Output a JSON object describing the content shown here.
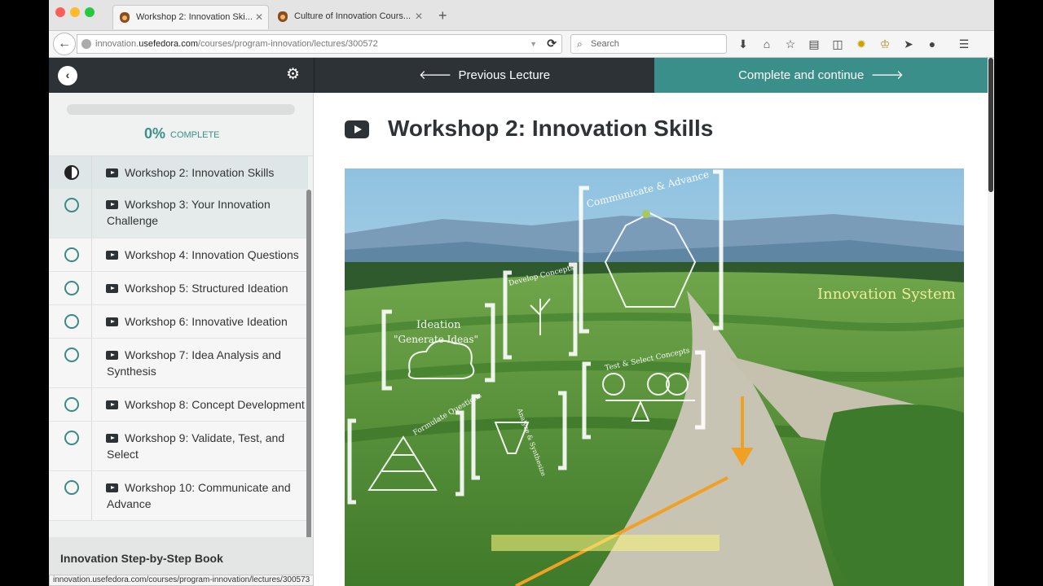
{
  "browser": {
    "tabs": [
      {
        "label": "Workshop 2: Innovation Ski...",
        "active": true
      },
      {
        "label": "Culture of Innovation Cours...",
        "active": false
      }
    ],
    "url_prefix": "innovation.",
    "url_domain": "usefedora.com",
    "url_path": "/courses/program-innovation/lectures/300572",
    "search_placeholder": "Search",
    "status_url": "innovation.usefedora.com/courses/program-innovation/lectures/300573"
  },
  "course_nav": {
    "previous_label": "Previous Lecture",
    "next_label": "Complete and continue"
  },
  "sidebar": {
    "progress_percent": "0%",
    "progress_label": "COMPLETE",
    "lectures": [
      {
        "title": "Workshop 2: Innovation Skills",
        "status": "in-progress"
      },
      {
        "title": "Workshop 3: Your Innovation Challenge",
        "status": "not-started"
      },
      {
        "title": "Workshop 4: Innovation Questions",
        "status": "not-started"
      },
      {
        "title": "Workshop 5: Structured Ideation",
        "status": "not-started"
      },
      {
        "title": "Workshop 6: Innovative Ideation",
        "status": "not-started"
      },
      {
        "title": "Workshop 7: Idea Analysis and Synthesis",
        "status": "not-started"
      },
      {
        "title": "Workshop 8: Concept Development",
        "status": "not-started"
      },
      {
        "title": "Workshop 9: Validate, Test, and Select",
        "status": "not-started"
      },
      {
        "title": "Workshop 10: Communicate and Advance",
        "status": "not-started"
      }
    ],
    "section_title": "Innovation Step-by-Step Book"
  },
  "main": {
    "lecture_title": "Workshop 2: Innovation Skills",
    "video_labels": {
      "system": "Innovation System",
      "ideation": "Ideation",
      "ideation_sub": "\"Generate Ideas\"",
      "develop": "Develop Concepts",
      "communicate": "Communicate & Advance",
      "test": "Test & Select Concepts",
      "questions": "Formulate Questions",
      "analyze": "Analyze & Synthesize"
    }
  },
  "colors": {
    "accent": "#3b8f8a",
    "dark": "#2d3236"
  }
}
